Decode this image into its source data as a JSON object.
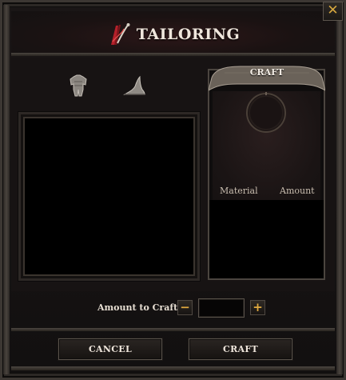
{
  "window": {
    "title": "TAILORING",
    "close_label": "✕"
  },
  "tabs": [
    {
      "icon": "armor-icon"
    },
    {
      "icon": "hat-icon"
    }
  ],
  "craft_panel": {
    "banner_label": "CRAFT",
    "columns": {
      "material": "Material",
      "amount": "Amount"
    }
  },
  "amount": {
    "label": "Amount to Craft",
    "minus_label": "−",
    "plus_label": "+",
    "value": ""
  },
  "buttons": {
    "cancel": "CANCEL",
    "craft": "CRAFT"
  },
  "colors": {
    "accent": "#e0a93f",
    "text": "#efe6dc",
    "title_icon_red": "#b3202a"
  }
}
